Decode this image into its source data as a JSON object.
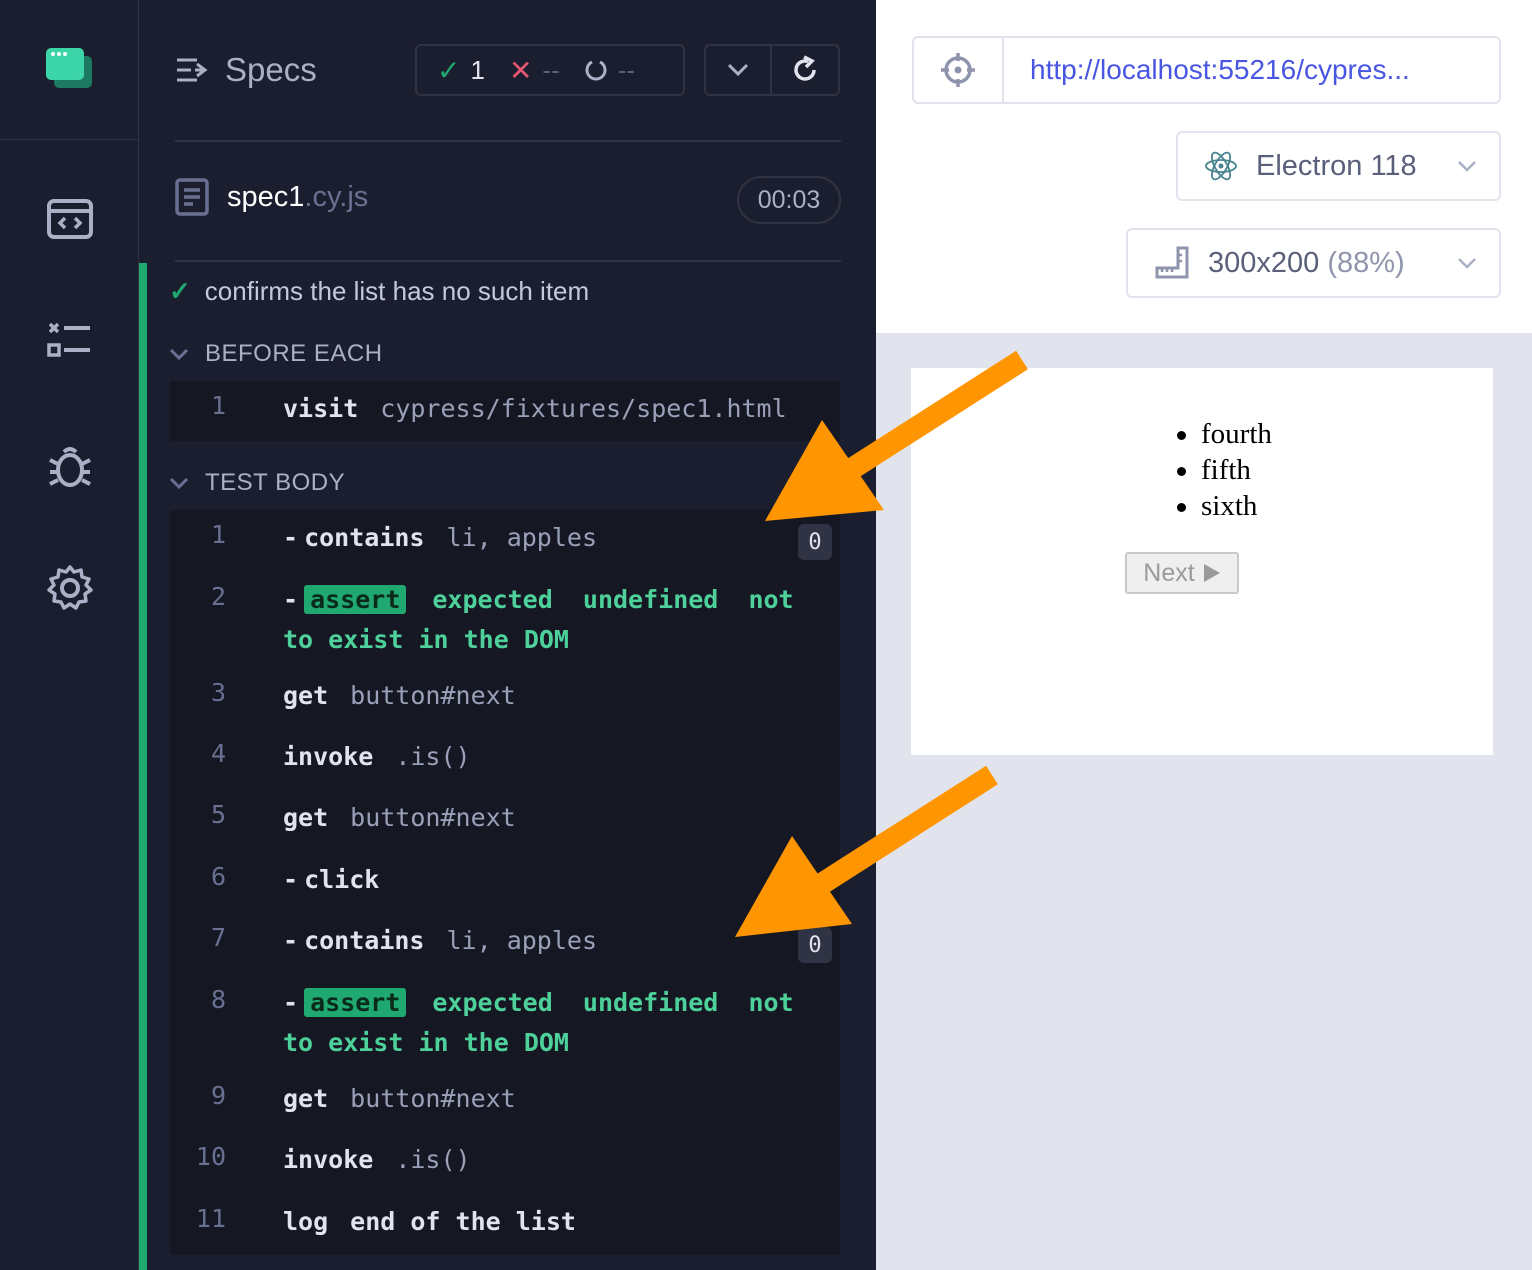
{
  "reporter": {
    "title": "Specs",
    "stats": {
      "passed": "1",
      "failed": "--",
      "pending": "--"
    },
    "spec_name": "spec1",
    "spec_ext": ".cy.js",
    "timer": "00:03",
    "test_title": "confirms the list has no such item",
    "before_each_label": "BEFORE EACH",
    "test_body_label": "TEST BODY",
    "before_each": [
      {
        "num": "1",
        "name": "visit",
        "arg": "cypress/fixtures/spec1.html"
      }
    ],
    "commands": [
      {
        "num": "1",
        "child": "-",
        "name": "contains",
        "arg": "li, apples",
        "badge": "0"
      },
      {
        "num": "2",
        "child": "-",
        "tag": "assert",
        "line1": "expected  undefined  not",
        "line2": "to exist in the DOM"
      },
      {
        "num": "3",
        "name": "get",
        "arg": "button#next"
      },
      {
        "num": "4",
        "name": "invoke",
        "arg": ".is()"
      },
      {
        "num": "5",
        "name": "get",
        "arg": "button#next"
      },
      {
        "num": "6",
        "child": "-",
        "name": "click"
      },
      {
        "num": "7",
        "child": "-",
        "name": "contains",
        "arg": "li, apples",
        "badge": "0"
      },
      {
        "num": "8",
        "child": "-",
        "tag": "assert",
        "line1": "expected  undefined  not",
        "line2": "to exist in the DOM"
      },
      {
        "num": "9",
        "name": "get",
        "arg": "button#next"
      },
      {
        "num": "10",
        "name": "invoke",
        "arg": ".is()"
      },
      {
        "num": "11",
        "name": "log",
        "arg": "end of the list",
        "arg_bold": true
      }
    ]
  },
  "browser": {
    "url": "http://localhost:55216/cypres...",
    "browser_label": "Electron 118",
    "viewport": "300x200",
    "scale": "(88%)"
  },
  "aut": {
    "items": [
      "fourth",
      "fifth",
      "sixth"
    ],
    "next_label": "Next"
  },
  "colors": {
    "pass": "#1fa971",
    "fail": "#e45770",
    "annotation_arrow": "#ff9500",
    "url": "#4956e3"
  }
}
